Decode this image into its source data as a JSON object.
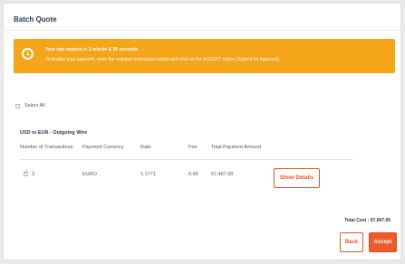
{
  "page": {
    "title": "Batch Quote"
  },
  "banner": {
    "icon": "clock-icon",
    "color": "#f5a51a",
    "headline": "Your rate expires in 1 minute & 55 seconds.",
    "instructions": "To finalize your payment, enter the required information below and click on the ACCEPT button (Submit for Approval)."
  },
  "select_all": {
    "label": "Select All",
    "checked": false
  },
  "group": {
    "title": "USD to EUR - Outgoing Wire",
    "columns": [
      "Number of Transactions",
      "Payment Currency",
      "Rate",
      "Fee",
      "Total Payment Amount"
    ],
    "rows": [
      {
        "checked": true,
        "transactions": "3",
        "currency": "EURO",
        "rate": "1.1771",
        "fee": "0.00",
        "total": "57,467.00",
        "action_label": "Show Details"
      }
    ]
  },
  "footer": {
    "total_cost": "Total Cost : 67,667.95",
    "back_label": "Back",
    "accept_label": "Accept",
    "accent_color": "#f05a28"
  }
}
